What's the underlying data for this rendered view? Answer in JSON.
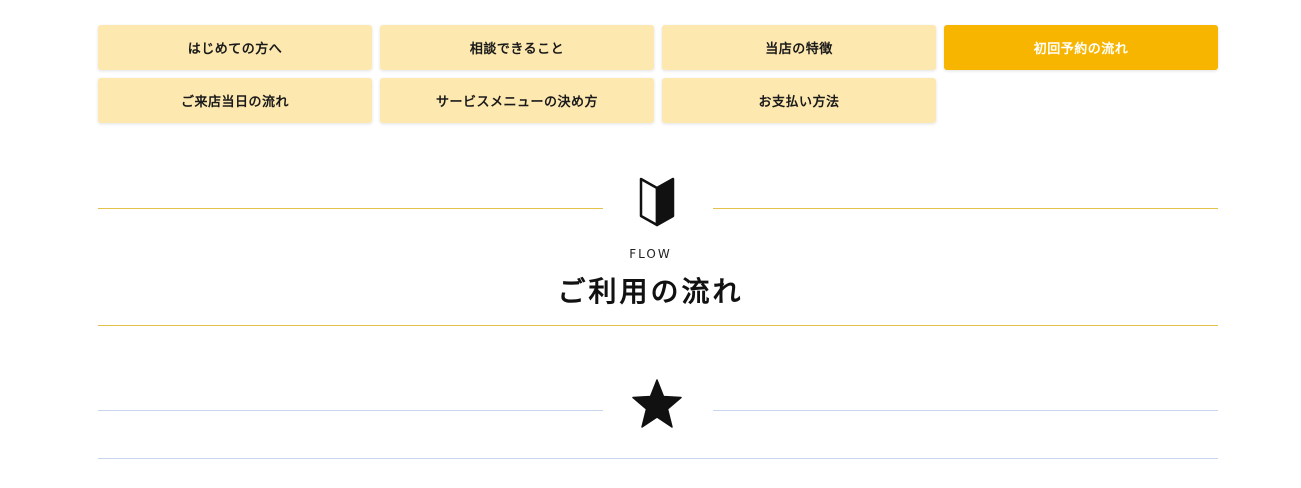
{
  "nav": {
    "tabs": [
      {
        "label": "はじめての方へ",
        "active": false
      },
      {
        "label": "相談できること",
        "active": false
      },
      {
        "label": "当店の特徴",
        "active": false
      },
      {
        "label": "初回予約の流れ",
        "active": true
      },
      {
        "label": "ご来店当日の流れ",
        "active": false
      },
      {
        "label": "サービスメニューの決め方",
        "active": false
      },
      {
        "label": "お支払い方法",
        "active": false
      }
    ]
  },
  "section": {
    "icon": "book-icon",
    "eyebrow": "FLOW",
    "title": "ご利用の流れ"
  },
  "next_section": {
    "icon": "star-icon"
  },
  "colors": {
    "tab_bg": "#fde8b0",
    "tab_active_bg": "#f7b500",
    "gold_rule": "#e3c14a",
    "blue_rule": "#c8d7ee"
  }
}
